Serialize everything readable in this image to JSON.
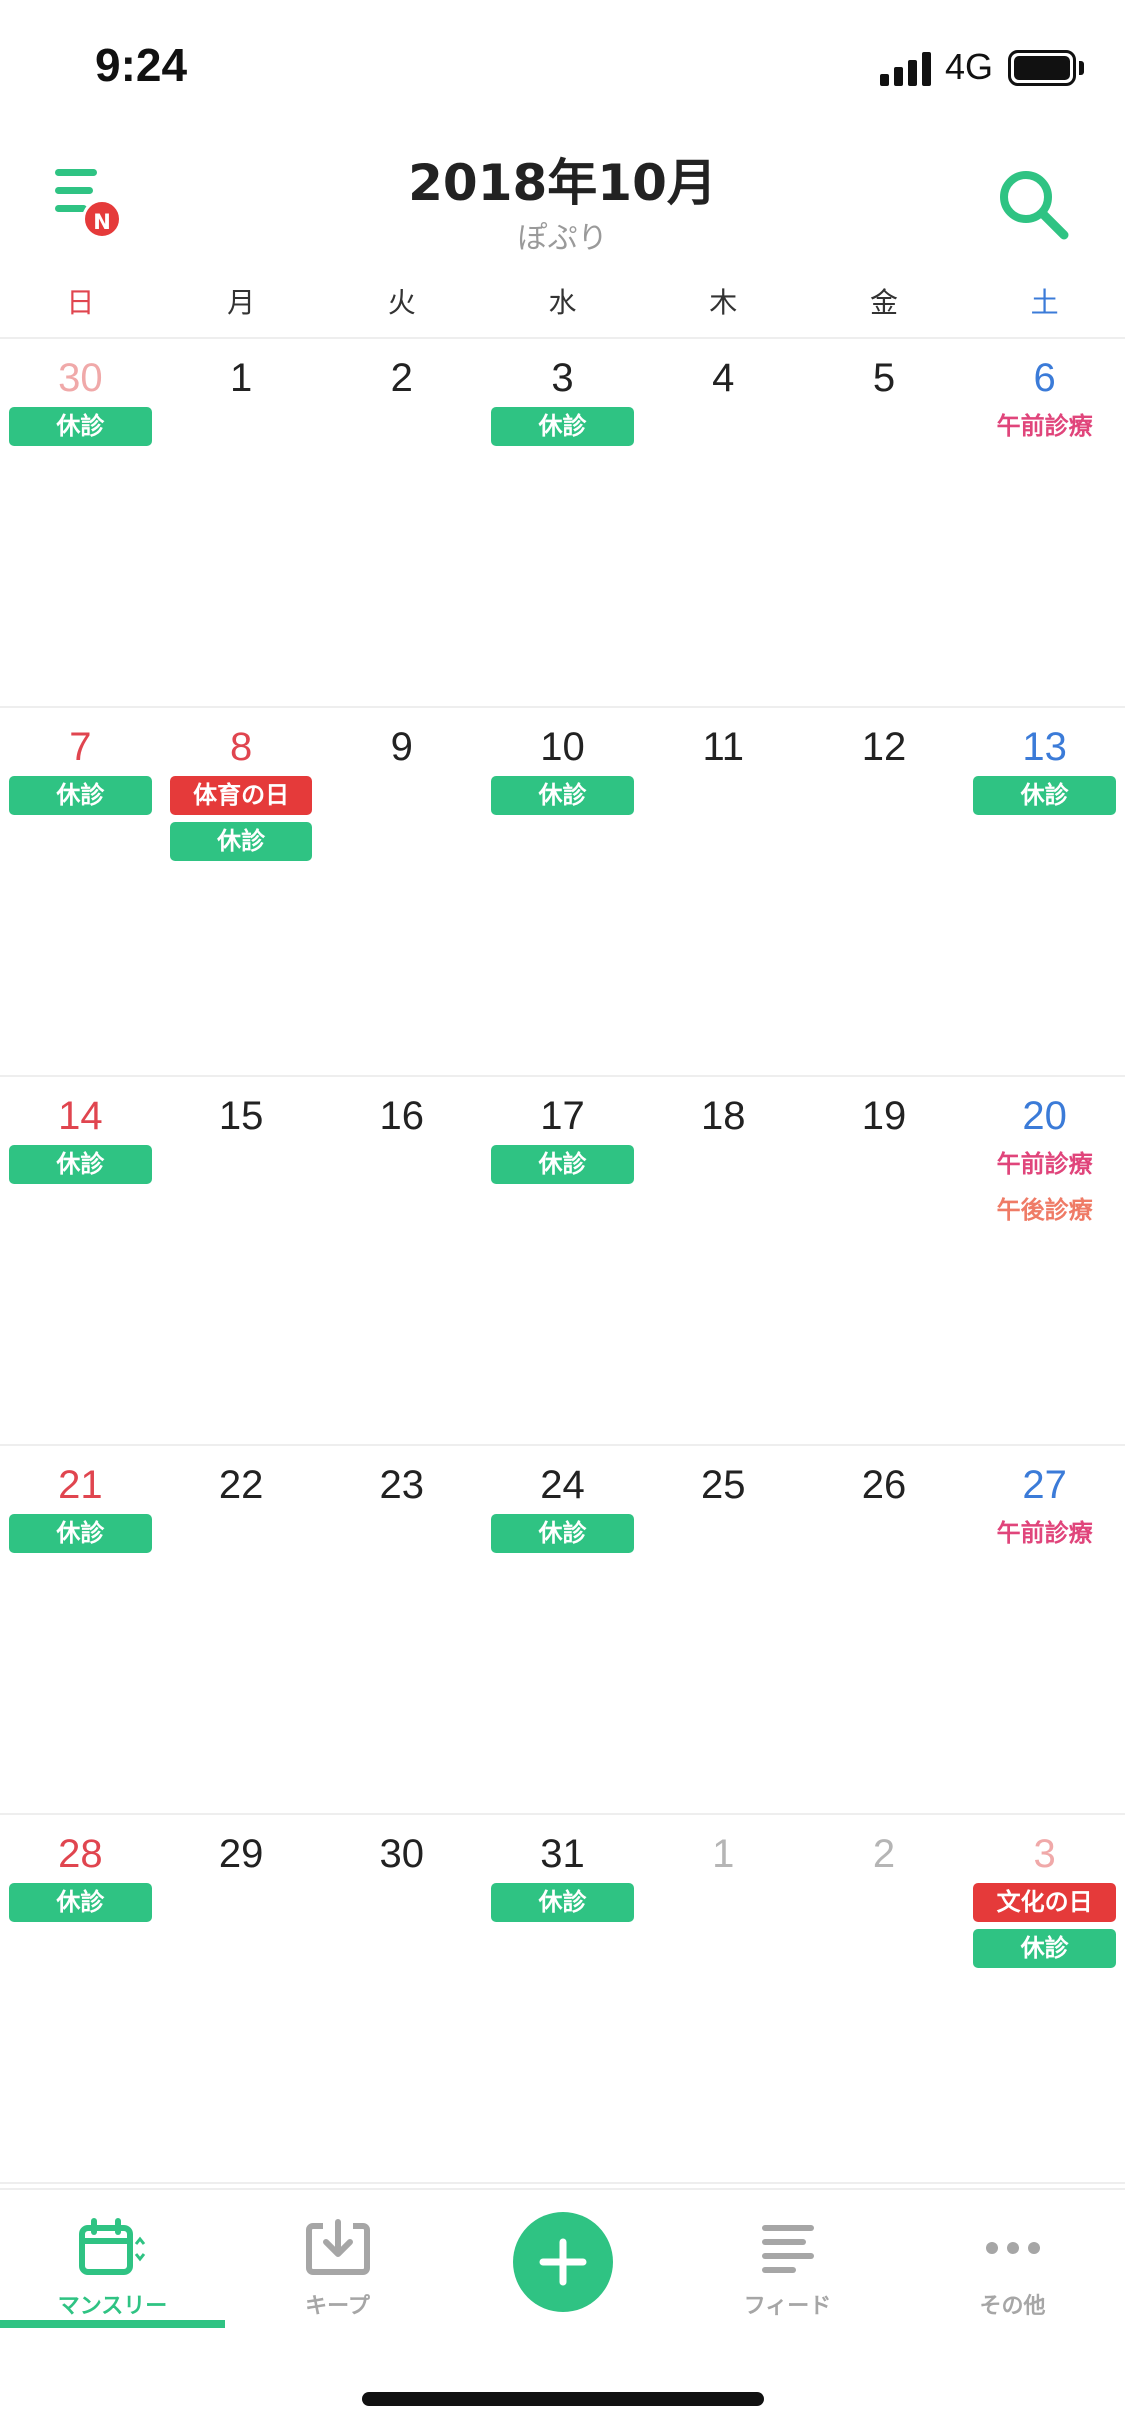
{
  "status_bar": {
    "time": "9:24",
    "network": "4G"
  },
  "header": {
    "title": "2018年10月",
    "subtitle": "ぽぷり",
    "menu_badge": "N"
  },
  "weekdays": [
    {
      "label": "日",
      "color": "#e0454f"
    },
    {
      "label": "月",
      "color": "#333333"
    },
    {
      "label": "火",
      "color": "#333333"
    },
    {
      "label": "水",
      "color": "#333333"
    },
    {
      "label": "木",
      "color": "#333333"
    },
    {
      "label": "金",
      "color": "#333333"
    },
    {
      "label": "土",
      "color": "#3b7bd8"
    }
  ],
  "colors": {
    "accent": "#2fc383",
    "holiday": "#e53a3a",
    "sunday": "#e0454f",
    "saturday": "#3b7bd8",
    "morning_text": "#e0457b",
    "afternoon_text": "#ef7b66"
  },
  "weeks": [
    [
      {
        "num": "30",
        "tone": "sun-dim",
        "events": [
          {
            "label": "休診",
            "style": "green"
          }
        ]
      },
      {
        "num": "1",
        "tone": "normal",
        "events": []
      },
      {
        "num": "2",
        "tone": "normal",
        "events": []
      },
      {
        "num": "3",
        "tone": "normal",
        "events": [
          {
            "label": "休診",
            "style": "green"
          }
        ]
      },
      {
        "num": "4",
        "tone": "normal",
        "events": []
      },
      {
        "num": "5",
        "tone": "normal",
        "events": []
      },
      {
        "num": "6",
        "tone": "sat",
        "events": [
          {
            "label": "午前診療",
            "style": "text-pink"
          }
        ]
      }
    ],
    [
      {
        "num": "7",
        "tone": "sun",
        "events": [
          {
            "label": "休診",
            "style": "green"
          }
        ]
      },
      {
        "num": "8",
        "tone": "sun",
        "events": [
          {
            "label": "体育の日",
            "style": "red"
          },
          {
            "label": "休診",
            "style": "green"
          }
        ]
      },
      {
        "num": "9",
        "tone": "normal",
        "events": []
      },
      {
        "num": "10",
        "tone": "normal",
        "events": [
          {
            "label": "休診",
            "style": "green"
          }
        ]
      },
      {
        "num": "11",
        "tone": "normal",
        "events": []
      },
      {
        "num": "12",
        "tone": "normal",
        "events": []
      },
      {
        "num": "13",
        "tone": "sat",
        "events": [
          {
            "label": "休診",
            "style": "green"
          }
        ]
      }
    ],
    [
      {
        "num": "14",
        "tone": "sun",
        "events": [
          {
            "label": "休診",
            "style": "green"
          }
        ]
      },
      {
        "num": "15",
        "tone": "normal",
        "events": []
      },
      {
        "num": "16",
        "tone": "normal",
        "events": []
      },
      {
        "num": "17",
        "tone": "normal",
        "events": [
          {
            "label": "休診",
            "style": "green"
          }
        ]
      },
      {
        "num": "18",
        "tone": "normal",
        "events": []
      },
      {
        "num": "19",
        "tone": "normal",
        "events": []
      },
      {
        "num": "20",
        "tone": "sat",
        "events": [
          {
            "label": "午前診療",
            "style": "text-pink"
          },
          {
            "label": "午後診療",
            "style": "text-salmon"
          }
        ]
      }
    ],
    [
      {
        "num": "21",
        "tone": "sun",
        "events": [
          {
            "label": "休診",
            "style": "green"
          }
        ]
      },
      {
        "num": "22",
        "tone": "normal",
        "events": []
      },
      {
        "num": "23",
        "tone": "normal",
        "events": []
      },
      {
        "num": "24",
        "tone": "normal",
        "events": [
          {
            "label": "休診",
            "style": "green"
          }
        ]
      },
      {
        "num": "25",
        "tone": "normal",
        "events": []
      },
      {
        "num": "26",
        "tone": "normal",
        "events": []
      },
      {
        "num": "27",
        "tone": "sat",
        "events": [
          {
            "label": "午前診療",
            "style": "text-pink"
          }
        ]
      }
    ],
    [
      {
        "num": "28",
        "tone": "sun",
        "events": [
          {
            "label": "休診",
            "style": "green"
          }
        ]
      },
      {
        "num": "29",
        "tone": "normal",
        "events": []
      },
      {
        "num": "30",
        "tone": "normal",
        "events": []
      },
      {
        "num": "31",
        "tone": "normal",
        "events": [
          {
            "label": "休診",
            "style": "green"
          }
        ]
      },
      {
        "num": "1",
        "tone": "dim",
        "events": []
      },
      {
        "num": "2",
        "tone": "dim",
        "events": []
      },
      {
        "num": "3",
        "tone": "sun-dim",
        "events": [
          {
            "label": "文化の日",
            "style": "red"
          },
          {
            "label": "休診",
            "style": "green"
          }
        ]
      }
    ]
  ],
  "tabs": [
    {
      "key": "monthly",
      "label": "マンスリー",
      "icon": "calendar-icon",
      "active": true
    },
    {
      "key": "keep",
      "label": "キープ",
      "icon": "download-tray-icon",
      "active": false
    },
    {
      "key": "add",
      "label": "",
      "icon": "plus-icon",
      "active": false
    },
    {
      "key": "feed",
      "label": "フィード",
      "icon": "feed-lines-icon",
      "active": false
    },
    {
      "key": "more",
      "label": "その他",
      "icon": "more-dots-icon",
      "active": false
    }
  ]
}
